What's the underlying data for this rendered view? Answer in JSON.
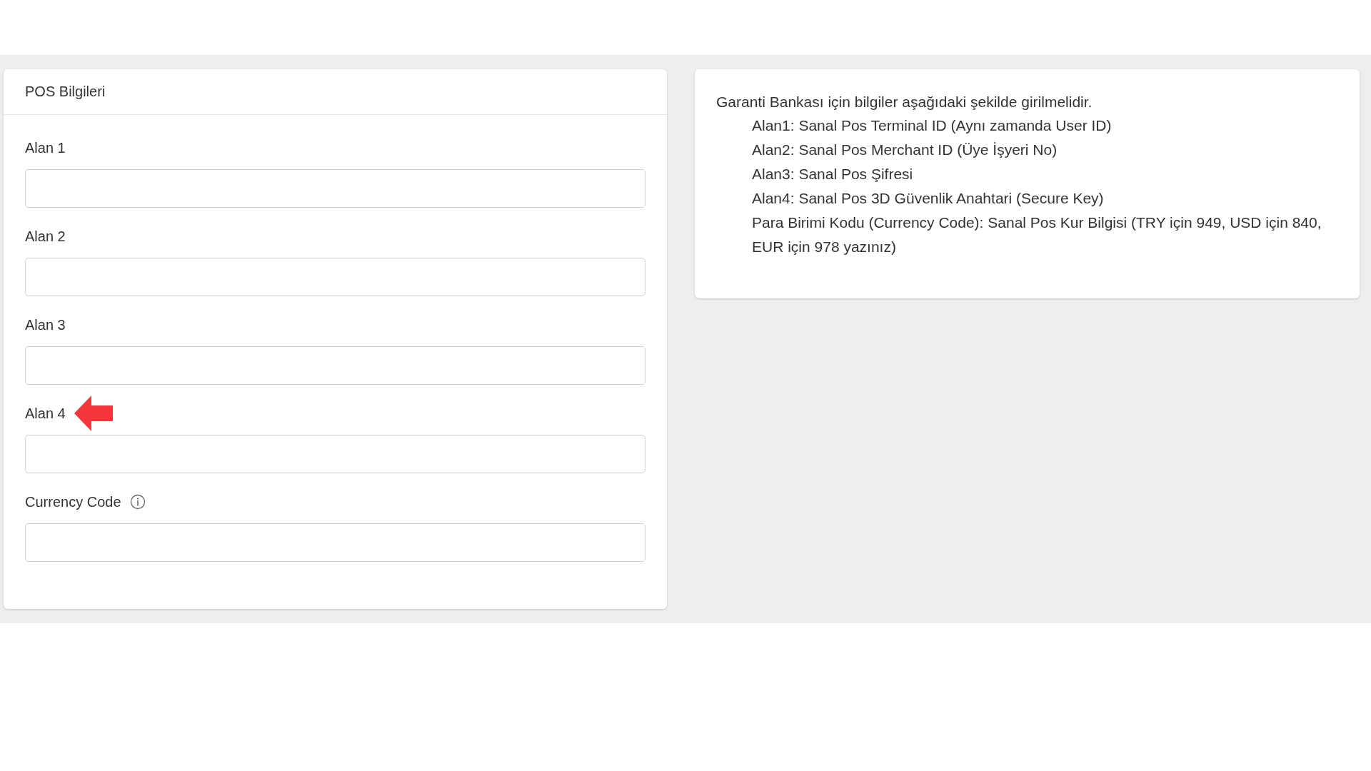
{
  "pos_card": {
    "title": "POS Bilgileri",
    "fields": [
      {
        "label": "Alan 1",
        "has_info": false,
        "annotated": false
      },
      {
        "label": "Alan 2",
        "has_info": false,
        "annotated": false
      },
      {
        "label": "Alan 3",
        "has_info": false,
        "annotated": false
      },
      {
        "label": "Alan 4",
        "has_info": false,
        "annotated": true
      },
      {
        "label": "Currency Code",
        "has_info": true,
        "annotated": false
      }
    ]
  },
  "info_card": {
    "intro": "Garanti Bankası için bilgiler aşağıdaki şekilde girilmelidir.",
    "lines": [
      "Alan1: Sanal Pos Terminal ID (Aynı zamanda User ID)",
      "Alan2: Sanal Pos Merchant ID (Üye İşyeri No)",
      "Alan3: Sanal Pos Şifresi",
      "Alan4: Sanal Pos 3D Güvenlik Anahtari (Secure Key)",
      "Para Birimi Kodu (Currency Code): Sanal Pos Kur Bilgisi (TRY için 949, USD için 840, EUR için 978 yazınız)"
    ]
  }
}
